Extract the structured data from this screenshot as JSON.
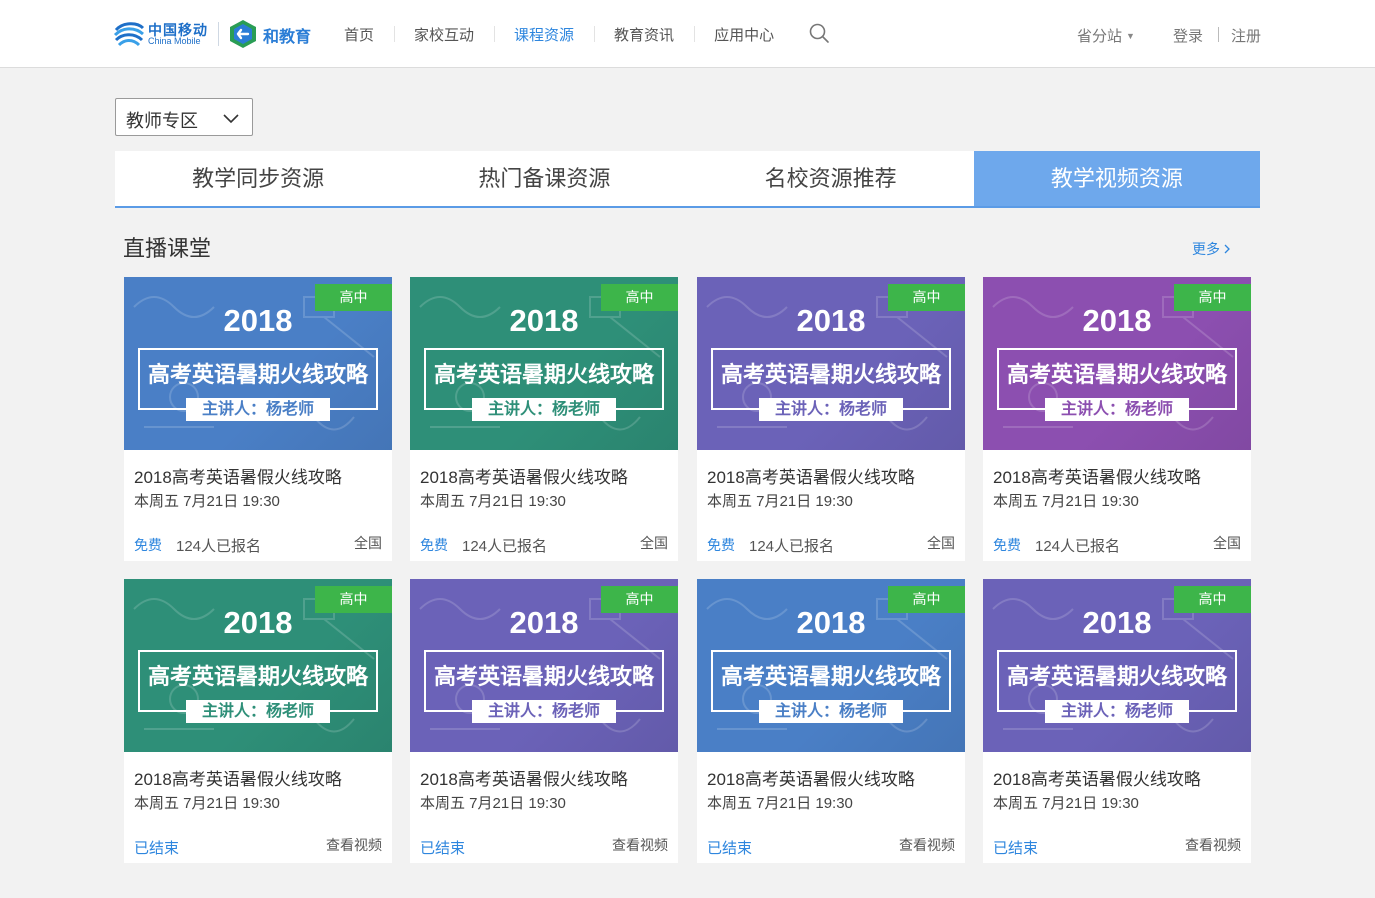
{
  "brand": {
    "cm_cn": "中国移动",
    "cm_en": "China Mobile",
    "he_name": "和教育"
  },
  "nav": {
    "items": [
      {
        "label": "首页",
        "active": false
      },
      {
        "label": "家校互动",
        "active": false
      },
      {
        "label": "课程资源",
        "active": true
      },
      {
        "label": "教育资讯",
        "active": false
      },
      {
        "label": "应用中心",
        "active": false
      }
    ],
    "search_icon": "search-icon",
    "province": "省分站",
    "login": "登录",
    "register": "注册"
  },
  "zone_select": {
    "value": "教师专区"
  },
  "tabs": [
    {
      "label": "教学同步资源",
      "active": false
    },
    {
      "label": "热门备课资源",
      "active": false
    },
    {
      "label": "名校资源推荐",
      "active": false
    },
    {
      "label": "教学视频资源",
      "active": true
    }
  ],
  "section": {
    "title": "直播课堂",
    "more": "更多"
  },
  "colors": {
    "accent": "#2e86de",
    "tab_active": "#6ea8ec",
    "badge_green": "#3db54a",
    "blue": "#4a7fc6",
    "green": "#2e8f78",
    "violet": "#6b62b8",
    "purple": "#8c4fb0"
  },
  "cards": [
    {
      "theme": "blue",
      "level": "高中",
      "year": "2018",
      "headline": "高考英语暑期火线攻略",
      "speaker": "主讲人：杨老师",
      "title": "2018高考英语暑假火线攻略",
      "time": "本周五 7月21日 19:30",
      "status": "免费",
      "count": "124人已报名",
      "scope": "全国"
    },
    {
      "theme": "green",
      "level": "高中",
      "year": "2018",
      "headline": "高考英语暑期火线攻略",
      "speaker": "主讲人：杨老师",
      "title": "2018高考英语暑假火线攻略",
      "time": "本周五 7月21日 19:30",
      "status": "免费",
      "count": "124人已报名",
      "scope": "全国"
    },
    {
      "theme": "violet",
      "level": "高中",
      "year": "2018",
      "headline": "高考英语暑期火线攻略",
      "speaker": "主讲人：杨老师",
      "title": "2018高考英语暑假火线攻略",
      "time": "本周五 7月21日 19:30",
      "status": "免费",
      "count": "124人已报名",
      "scope": "全国"
    },
    {
      "theme": "purple",
      "level": "高中",
      "year": "2018",
      "headline": "高考英语暑期火线攻略",
      "speaker": "主讲人：杨老师",
      "title": "2018高考英语暑假火线攻略",
      "time": "本周五 7月21日 19:30",
      "status": "免费",
      "count": "124人已报名",
      "scope": "全国"
    },
    {
      "theme": "green",
      "level": "高中",
      "year": "2018",
      "headline": "高考英语暑期火线攻略",
      "speaker": "主讲人：杨老师",
      "title": "2018高考英语暑假火线攻略",
      "time": "本周五 7月21日 19:30",
      "status": "已结束",
      "count": "",
      "scope": "查看视频"
    },
    {
      "theme": "violet",
      "level": "高中",
      "year": "2018",
      "headline": "高考英语暑期火线攻略",
      "speaker": "主讲人：杨老师",
      "title": "2018高考英语暑假火线攻略",
      "time": "本周五 7月21日 19:30",
      "status": "已结束",
      "count": "",
      "scope": "查看视频"
    },
    {
      "theme": "blue",
      "level": "高中",
      "year": "2018",
      "headline": "高考英语暑期火线攻略",
      "speaker": "主讲人：杨老师",
      "title": "2018高考英语暑假火线攻略",
      "time": "本周五 7月21日 19:30",
      "status": "已结束",
      "count": "",
      "scope": "查看视频"
    },
    {
      "theme": "violet",
      "level": "高中",
      "year": "2018",
      "headline": "高考英语暑期火线攻略",
      "speaker": "主讲人：杨老师",
      "title": "2018高考英语暑假火线攻略",
      "time": "本周五 7月21日 19:30",
      "status": "已结束",
      "count": "",
      "scope": "查看视频"
    }
  ]
}
